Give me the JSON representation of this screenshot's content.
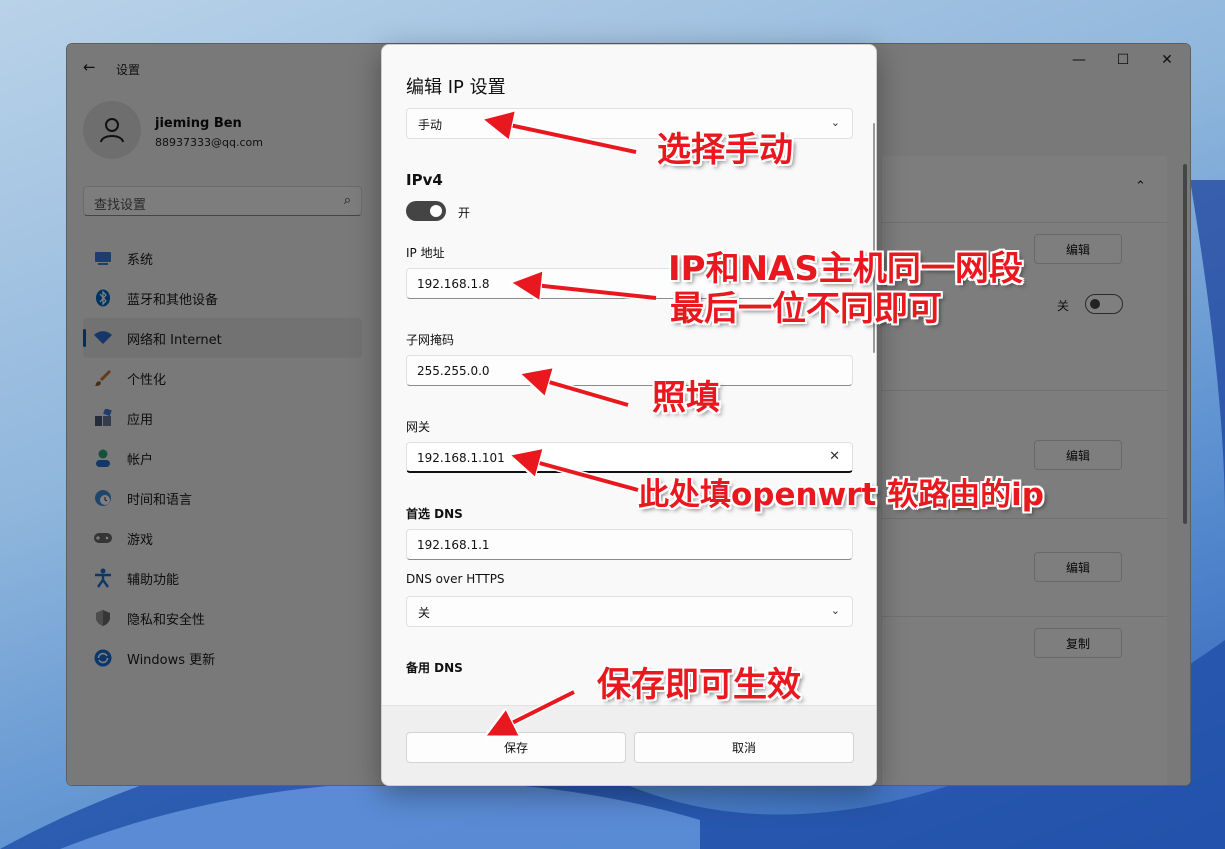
{
  "window": {
    "back_glyph": "←",
    "title": "设置",
    "controls": {
      "minimize": "—",
      "maximize": "☐",
      "close": "✕"
    }
  },
  "user": {
    "name": "jieming Ben",
    "email": "88937333@qq.com"
  },
  "search": {
    "placeholder": "查找设置"
  },
  "sidebar": {
    "items": [
      {
        "label": "系统",
        "icon": "system-icon",
        "color": "#3a7bd5"
      },
      {
        "label": "蓝牙和其他设备",
        "icon": "bluetooth-icon",
        "color": "#0067c0"
      },
      {
        "label": "网络和 Internet",
        "icon": "wifi-icon",
        "color": "#2f6fd1",
        "selected": true
      },
      {
        "label": "个性化",
        "icon": "brush-icon",
        "color": "#c9772c"
      },
      {
        "label": "应用",
        "icon": "apps-icon",
        "color": "#4a5a78"
      },
      {
        "label": "帐户",
        "icon": "account-icon",
        "color": "#2aa37a"
      },
      {
        "label": "时间和语言",
        "icon": "clock-globe-icon",
        "color": "#3d8ad6"
      },
      {
        "label": "游戏",
        "icon": "gamepad-icon",
        "color": "#6b6b6b"
      },
      {
        "label": "辅助功能",
        "icon": "accessibility-icon",
        "color": "#1c6ed0"
      },
      {
        "label": "隐私和安全性",
        "icon": "shield-icon",
        "color": "#6c6c6c"
      },
      {
        "label": "Windows 更新",
        "icon": "update-icon",
        "color": "#1a6fd6"
      }
    ]
  },
  "right_panel": {
    "edit_label": "编辑",
    "copy_label": "复制",
    "toggle_label": "关"
  },
  "dialog": {
    "title": "编辑 IP 设置",
    "mode": "手动",
    "ipv4_heading": "IPv4",
    "ipv4_toggle": "开",
    "ip_label": "IP 地址",
    "ip_value": "192.168.1.8",
    "mask_label": "子网掩码",
    "mask_value": "255.255.0.0",
    "gateway_label": "网关",
    "gateway_value": "192.168.1.101",
    "dns_label": "首选 DNS",
    "dns_value": "192.168.1.1",
    "doh_label": "DNS over HTTPS",
    "doh_value": "关",
    "alt_dns_label": "备用 DNS",
    "save_label": "保存",
    "cancel_label": "取消"
  },
  "annotations": {
    "select_manual": "选择手动",
    "ip_line1": "IP和NAS主机同一网段",
    "ip_line2": "最后一位不同即可",
    "fill_as_is": "照填",
    "gateway_note": "此处填openwrt 软路由的ip",
    "save_note": "保存即可生效",
    "color": "#e8181e"
  }
}
